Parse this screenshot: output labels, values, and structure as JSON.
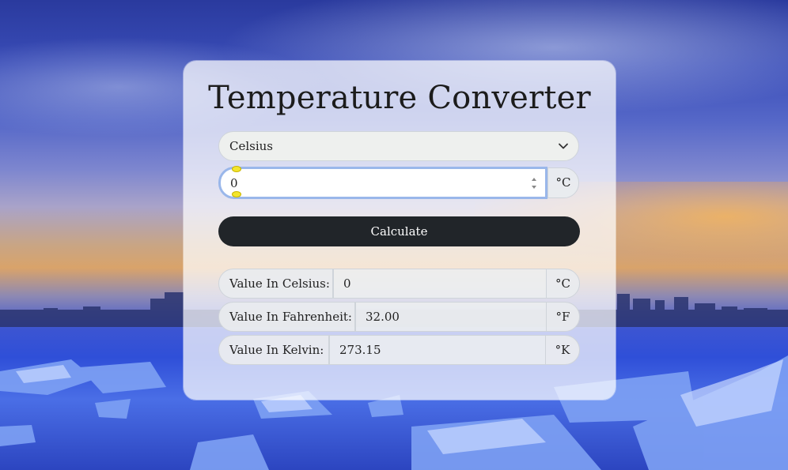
{
  "app": {
    "title": "Temperature Converter"
  },
  "unit_select": {
    "selected": "Celsius",
    "icon": "chevron-down-icon"
  },
  "input": {
    "value": "0",
    "unit": "°C"
  },
  "calculate_button": {
    "label": "Calculate"
  },
  "results": [
    {
      "label": "Value In Celsius:",
      "value": "0",
      "unit": "°C"
    },
    {
      "label": "Value In Fahrenheit:",
      "value": "32.00",
      "unit": "°F"
    },
    {
      "label": "Value In Kelvin:",
      "value": "273.15",
      "unit": "°K"
    }
  ],
  "colors": {
    "button_bg": "#212529",
    "focus_ring": "#9ab7ea",
    "card_bg": "rgba(255,255,255,0.72)"
  }
}
